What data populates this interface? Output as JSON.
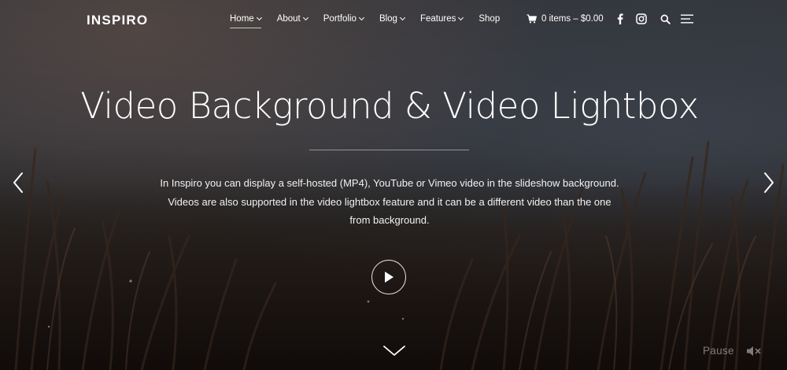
{
  "site": {
    "logo": "INSPIRO"
  },
  "nav": {
    "items": [
      {
        "label": "Home",
        "dropdown": true,
        "active": true
      },
      {
        "label": "About",
        "dropdown": true,
        "active": false
      },
      {
        "label": "Portfolio",
        "dropdown": true,
        "active": false
      },
      {
        "label": "Blog",
        "dropdown": true,
        "active": false
      },
      {
        "label": "Features",
        "dropdown": true,
        "active": false
      },
      {
        "label": "Shop",
        "dropdown": false,
        "active": false
      }
    ],
    "cart_label": "0 items – $0.00",
    "icons": [
      "cart-icon",
      "facebook-icon",
      "instagram-icon",
      "search-icon",
      "menu-icon"
    ]
  },
  "hero": {
    "title": "Video Background & Video Lightbox",
    "description_lines": [
      "In Inspiro you can display a self-hosted (MP4), YouTube or Vimeo video in the slideshow background.",
      "Videos are also supported in the video lightbox feature and it can be a different video than the one",
      "from background."
    ],
    "icons": [
      "chevron-left-icon",
      "chevron-right-icon",
      "play-icon",
      "chevron-down-icon",
      "mute-icon"
    ]
  },
  "controls": {
    "pause_label": "Pause"
  }
}
